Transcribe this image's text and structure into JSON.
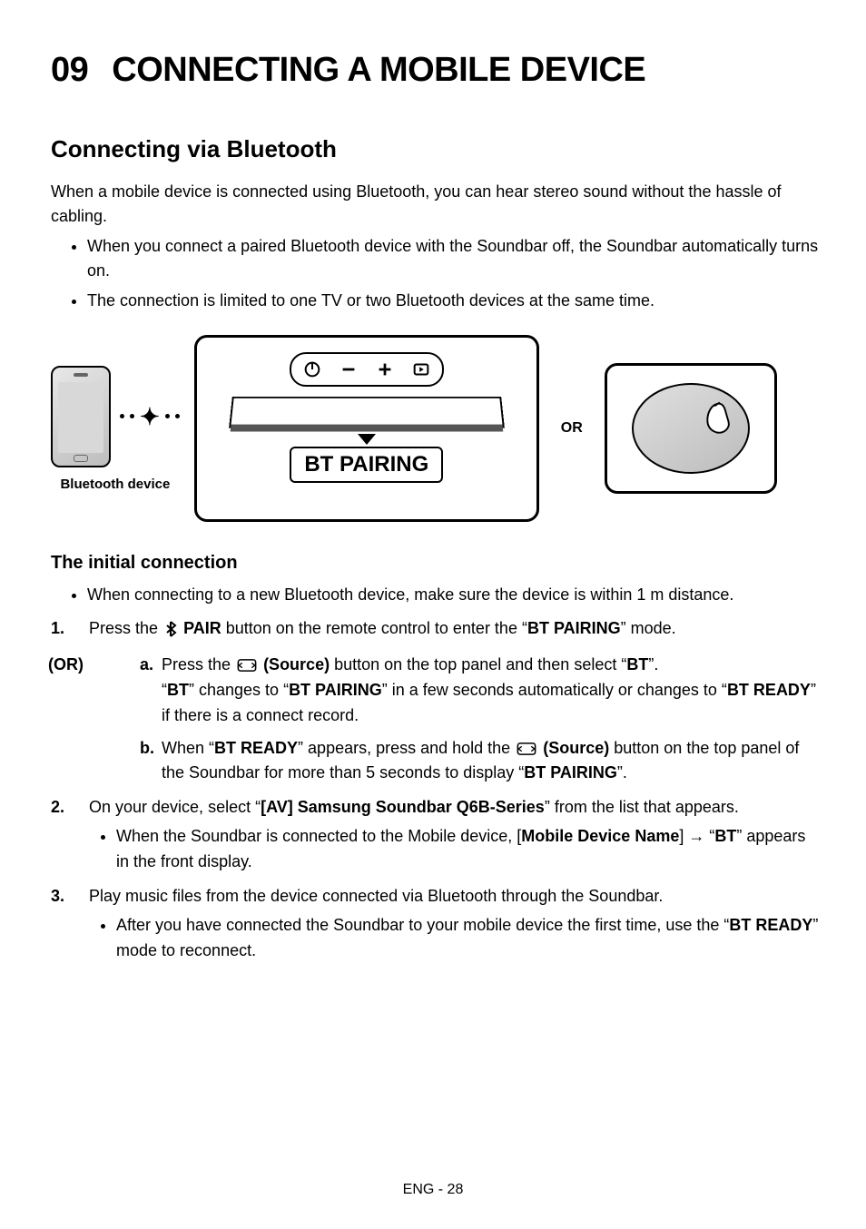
{
  "header": {
    "section_number": "09",
    "title": "CONNECTING A MOBILE DEVICE"
  },
  "section": {
    "subtitle": "Connecting via Bluetooth",
    "intro": "When a mobile device is connected using Bluetooth, you can hear stereo sound without the hassle of cabling.",
    "bullets": [
      "When you connect a paired Bluetooth device with the Soundbar off, the Soundbar automatically turns on.",
      "The connection is limited to one TV or two Bluetooth devices at the same time."
    ]
  },
  "diagram": {
    "device_label": "Bluetooth device",
    "callout": "BT PAIRING",
    "or_label": "OR"
  },
  "steps": {
    "heading": "The initial connection",
    "pre_bullet": "When connecting to a new Bluetooth device, make sure the device is within 1 m distance.",
    "or_text": "(OR)",
    "step1": {
      "pre": "Press the ",
      "icon_label": "PAIR",
      "mid": " button on the remote control to enter the “",
      "mode": "BT PAIRING",
      "post": "” mode."
    },
    "step1a": {
      "pre": "Press the ",
      "icon_label": "(Source)",
      "mid": " button on the top panel and then select “",
      "bt": "BT",
      "post": "”.",
      "line2_a": "“",
      "line2_bt": "BT",
      "line2_b": "” changes to “",
      "line2_pairing": "BT PAIRING",
      "line2_c": "” in a few seconds automatically or changes to “",
      "line2_ready": "BT READY",
      "line2_d": "” if there is a connect record."
    },
    "step1b": {
      "pre": "When “",
      "ready": "BT READY",
      "mid": "” appears, press and hold the ",
      "icon_label": "(Source)",
      "mid2": " button on the top panel of the Soundbar for more than 5 seconds to display “",
      "pairing": "BT PAIRING",
      "post": "”."
    },
    "step2": {
      "pre": "On your device, select “",
      "name": "[AV] Samsung Soundbar Q6B-Series",
      "post": "” from the list that appears.",
      "sub_pre": "When the Soundbar is connected to the Mobile device, [",
      "sub_name": "Mobile Device Name",
      "sub_mid": "] → “",
      "sub_bt": "BT",
      "sub_post": "” appears in the front display."
    },
    "step3": {
      "text": "Play music files from the device connected via Bluetooth through the Soundbar.",
      "sub_pre": "After you have connected the Soundbar to your mobile device the first time, use the “",
      "sub_ready": "BT READY",
      "sub_post": "” mode to reconnect."
    }
  },
  "footer": "ENG - 28"
}
